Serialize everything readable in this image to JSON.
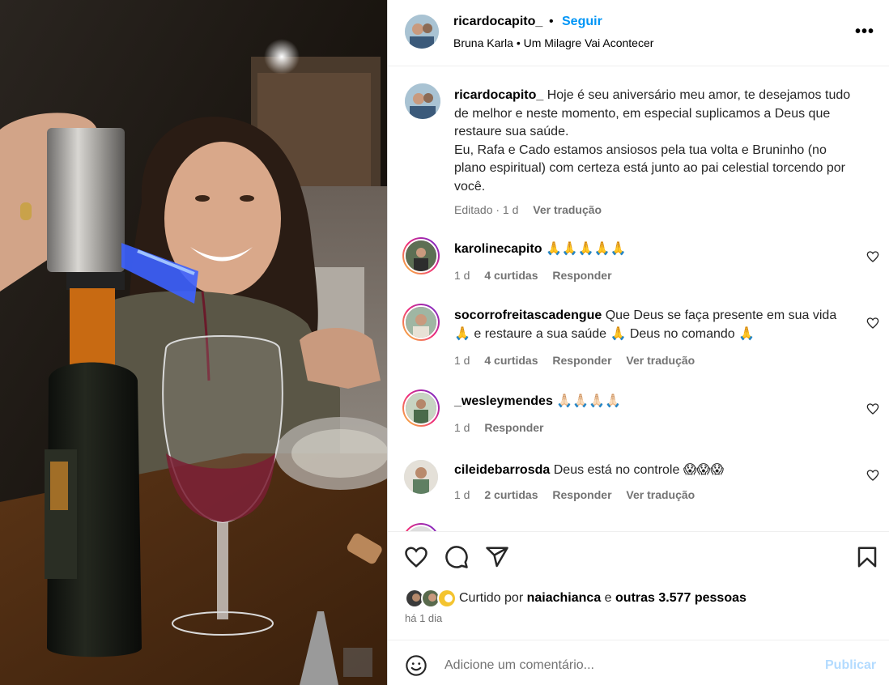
{
  "post": {
    "username": "ricardocapito_",
    "separator": "•",
    "follow_label": "Seguir",
    "audio": "Bruna Karla • Um Milagre Vai Acontecer",
    "more_icon": "more-horizontal-icon"
  },
  "caption": {
    "username": "ricardocapito_",
    "text_line1": "Hoje é seu aniversário meu amor, te desejamos tudo de melhor e neste momento, em especial suplicamos a Deus que restaure sua saúde.",
    "text_line2": "Eu, Rafa e Cado estamos ansiosos pela tua volta e Bruninho (no plano espiritual) com certeza está junto ao pai celestial torcendo por você.",
    "edited": "Editado · 1 d",
    "translate": "Ver tradução"
  },
  "comments": [
    {
      "username": "karolinecapito",
      "text": "🙏🙏🙏🙏🙏",
      "time": "1 d",
      "likes": "4 curtidas",
      "reply": "Responder",
      "translate": ""
    },
    {
      "username": "socorrofreitascadengue",
      "text": "Que Deus se faça presente em sua vida 🙏 e restaure a sua saúde 🙏 Deus no comando 🙏",
      "time": "1 d",
      "likes": "4 curtidas",
      "reply": "Responder",
      "translate": "Ver tradução"
    },
    {
      "username": "_wesleymendes",
      "text": "🙏🏻🙏🏻🙏🏻🙏🏻",
      "time": "1 d",
      "likes": "",
      "reply": "Responder",
      "translate": ""
    },
    {
      "username": "cileidebarrosda",
      "text": "Deus está no controle 😱😱😱",
      "time": "1 d",
      "likes": "2 curtidas",
      "reply": "Responder",
      "translate": "Ver tradução"
    }
  ],
  "actions": {
    "like_icon": "heart-icon",
    "comment_icon": "comment-icon",
    "share_icon": "share-icon",
    "save_icon": "bookmark-icon"
  },
  "likes": {
    "prefix": "Curtido por",
    "user": "naiachianca",
    "middle": "e",
    "others": "outras 3.577 pessoas"
  },
  "posted": "há 1 dia",
  "add_comment": {
    "placeholder": "Adicione um comentário...",
    "publish_label": "Publicar",
    "emoji_icon": "emoji-icon"
  },
  "colors": {
    "link_blue": "#0095f6",
    "publish_disabled": "#b3dbff",
    "muted": "#737373"
  }
}
